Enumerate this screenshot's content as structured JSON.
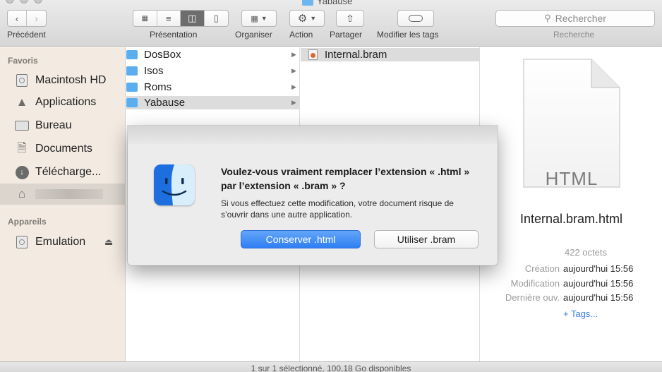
{
  "window": {
    "title": "Yabause"
  },
  "toolbar": {
    "back_label": "Précédent",
    "view_label": "Présentation",
    "arrange_label": "Organiser",
    "action_label": "Action",
    "share_label": "Partager",
    "tags_label": "Modifier les tags",
    "search_placeholder": "Rechercher",
    "search_label": "Recherche"
  },
  "sidebar": {
    "favorites_header": "Favoris",
    "favorites": [
      {
        "label": "Macintosh HD",
        "icon": "hard-drive-icon"
      },
      {
        "label": "Applications",
        "icon": "applications-icon"
      },
      {
        "label": "Bureau",
        "icon": "desktop-icon"
      },
      {
        "label": "Documents",
        "icon": "documents-icon"
      },
      {
        "label": "Télécharge...",
        "icon": "downloads-icon"
      },
      {
        "label": "",
        "icon": "home-icon"
      }
    ],
    "devices_header": "Appareils",
    "devices": [
      {
        "label": "Emulation",
        "icon": "hard-drive-icon"
      }
    ]
  },
  "column1": {
    "items": [
      {
        "name": "DosBox"
      },
      {
        "name": "Isos"
      },
      {
        "name": "Roms"
      },
      {
        "name": "Yabause"
      }
    ]
  },
  "column2": {
    "items": [
      {
        "name": "Internal.bram"
      }
    ]
  },
  "preview": {
    "doc_type": "HTML",
    "filename": "Internal.bram.html",
    "size": "422 octets",
    "created_label": "Création",
    "created_value": "aujourd'hui 15:56",
    "modified_label": "Modification",
    "modified_value": "aujourd'hui 15:56",
    "opened_label": "Dernière ouv.",
    "opened_value": "aujourd'hui 15:56",
    "tags_link": "+ Tags..."
  },
  "status": {
    "text": "1 sur 1 sélectionné, 100,18 Go disponibles"
  },
  "dialog": {
    "title": "Voulez-vous vraiment remplacer l’extension « .html » par l’extension « .bram » ?",
    "message": "Si vous effectuez cette modification, votre document risque de s’ouvrir dans une autre application.",
    "keep_button": "Conserver .html",
    "use_button": "Utiliser .bram"
  },
  "colors": {
    "accent": "#3a86f5",
    "sidebar_bg": "#f3ebe2",
    "folder": "#5aaef0",
    "tag_link": "#3b7fe0"
  }
}
